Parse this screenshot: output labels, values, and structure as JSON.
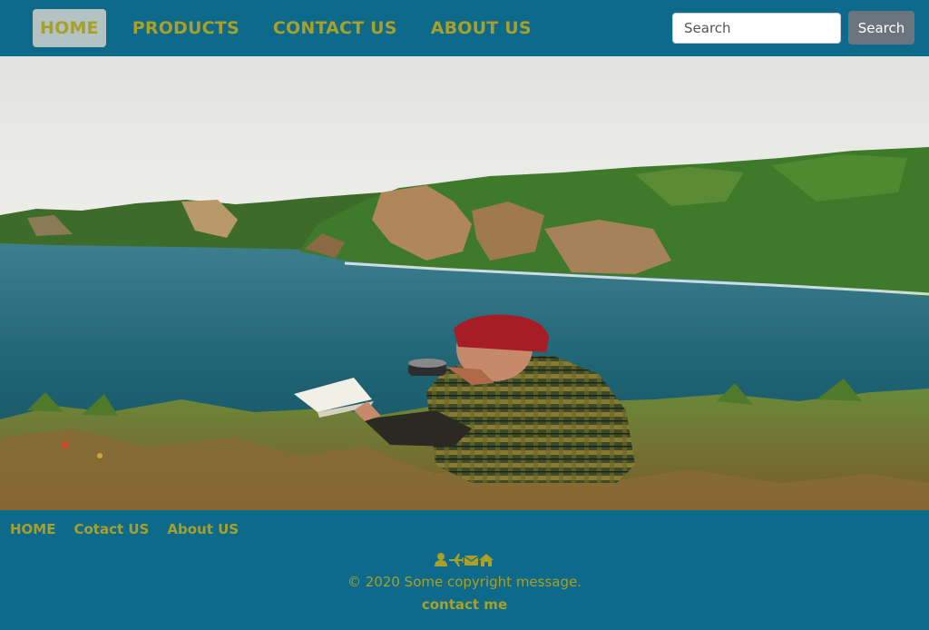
{
  "navbar": {
    "items": [
      {
        "label": "HOME",
        "active": true
      },
      {
        "label": "PRODUCTS",
        "active": false
      },
      {
        "label": "CONTACT US",
        "active": false
      },
      {
        "label": "ABOUT US",
        "active": false
      }
    ],
    "search": {
      "placeholder": "Search",
      "value": "",
      "button_label": "Search"
    }
  },
  "hero": {
    "image": "person-reading-by-coastal-cliffs-photo"
  },
  "footer": {
    "links": [
      {
        "label": "HOME"
      },
      {
        "label": "Cotact US"
      },
      {
        "label": "About US"
      }
    ],
    "icons": [
      "user-icon",
      "plane-icon",
      "envelope-icon",
      "home-icon"
    ],
    "copyright": "© 2020 Some copyright message.",
    "contact": "contact me"
  },
  "colors": {
    "background": "#0e6a8a",
    "accent_text": "#a8a028",
    "active_nav_bg": "#b3c2c2",
    "search_button": "#6c757d"
  }
}
